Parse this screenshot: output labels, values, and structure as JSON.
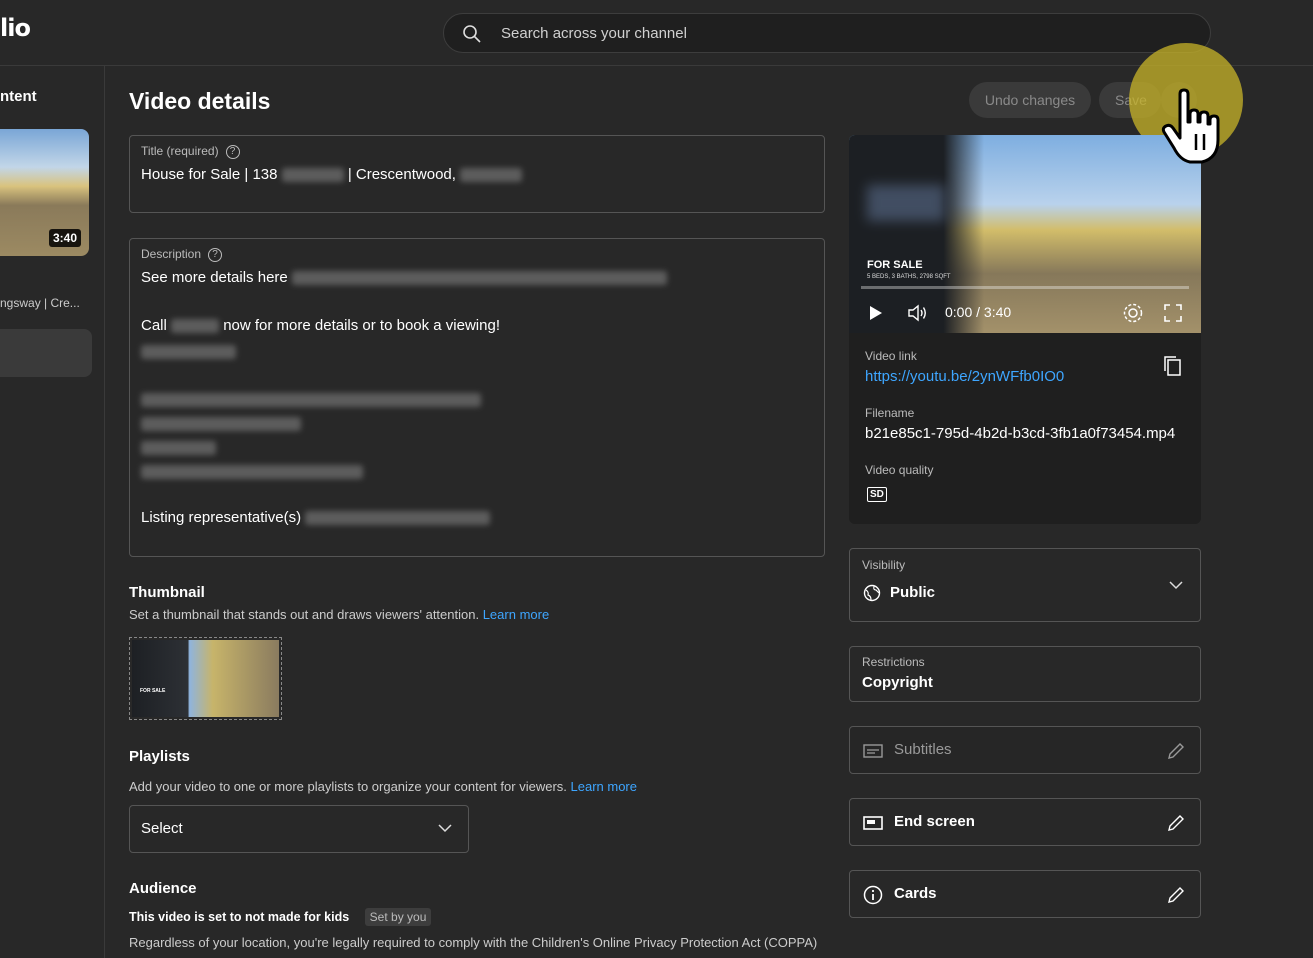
{
  "header": {
    "logo_fragment": "lio",
    "search_placeholder": "Search across your channel"
  },
  "sidebar": {
    "title_fragment": "ntent",
    "video_duration": "3:40",
    "video_name_fragment": "ngsway | Cre..."
  },
  "page": {
    "title": "Video details",
    "undo_label": "Undo changes",
    "save_label": "Save"
  },
  "title_field": {
    "label": "Title (required)",
    "part1": "House for Sale | 138",
    "part2": "| Crescentwood,"
  },
  "description_field": {
    "label": "Description",
    "line1": "See more details here",
    "line2a": "Call",
    "line2b": "now for more details or to book a viewing!",
    "line3": "Listing representative(s)"
  },
  "thumbnail": {
    "heading": "Thumbnail",
    "description": "Set a thumbnail that stands out and draws viewers' attention.",
    "learn_more": "Learn more",
    "overlay_text": "FOR SALE"
  },
  "playlists": {
    "heading": "Playlists",
    "description": "Add your video to one or more playlists to organize your content for viewers.",
    "learn_more": "Learn more",
    "select_value": "Select"
  },
  "audience": {
    "heading": "Audience",
    "status": "This video is set to not made for kids",
    "badge": "Set by you",
    "notice": "Regardless of your location, you're legally required to comply with the Children's Online Privacy Protection Act (COPPA)"
  },
  "video_panel": {
    "overlay_title": "FOR SALE",
    "overlay_sub": "5 BEDS, 3 BATHS, 2798 SQFT",
    "time": "0:00 / 3:40",
    "link_label": "Video link",
    "link_value": "https://youtu.be/2ynWFfb0IO0",
    "filename_label": "Filename",
    "filename_value": "b21e85c1-795d-4b2d-b3cd-3fb1a0f73454.mp4",
    "quality_label": "Video quality",
    "quality_badge": "SD"
  },
  "visibility": {
    "label": "Visibility",
    "value": "Public"
  },
  "restrictions": {
    "label": "Restrictions",
    "value": "Copyright"
  },
  "subtitles": {
    "label": "Subtitles"
  },
  "end_screen": {
    "label": "End screen"
  },
  "cards": {
    "label": "Cards"
  },
  "colors": {
    "background": "#282828",
    "link": "#3ea6ff",
    "highlight": "#c8b428"
  }
}
